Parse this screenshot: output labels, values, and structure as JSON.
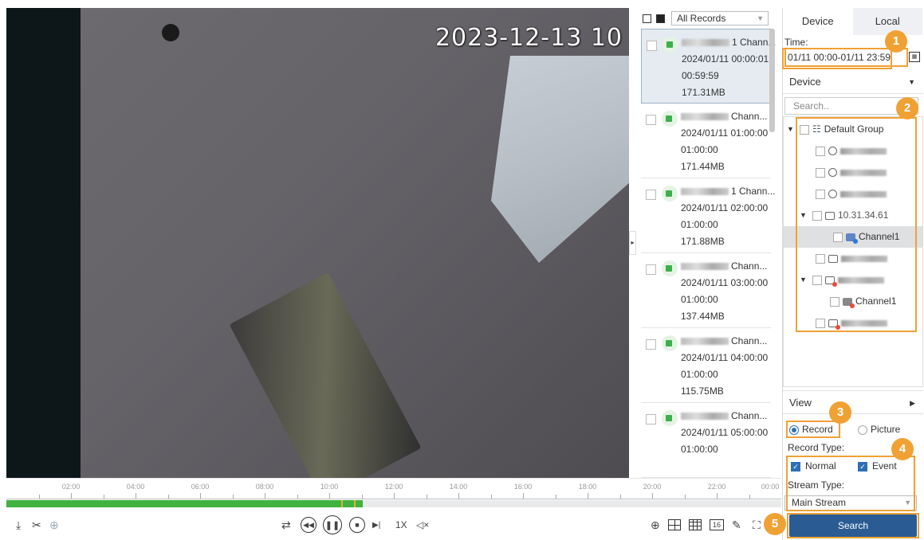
{
  "video": {
    "osd_timestamp": "2023-12-13 10"
  },
  "timeline": {
    "hour_labels": [
      "02:00",
      "04:00",
      "06:00",
      "08:00",
      "10:00",
      "12:00",
      "14:00",
      "16:00",
      "18:00",
      "20:00",
      "22:00",
      "00:00"
    ],
    "recorded_fraction": 0.46
  },
  "toolbar": {
    "speed": "1X",
    "grid_count": "16"
  },
  "records": {
    "filter": "All Records",
    "items": [
      {
        "channel": "1 Chann...",
        "start": "2024/01/11 00:00:01",
        "duration": "00:59:59",
        "size": "171.31MB",
        "selected": true
      },
      {
        "channel": "Chann...",
        "start": "2024/01/11 01:00:00",
        "duration": "01:00:00",
        "size": "171.44MB",
        "selected": false
      },
      {
        "channel": "1 Chann...",
        "start": "2024/01/11 02:00:00",
        "duration": "01:00:00",
        "size": "171.88MB",
        "selected": false
      },
      {
        "channel": "Chann...",
        "start": "2024/01/11 03:00:00",
        "duration": "01:00:00",
        "size": "137.44MB",
        "selected": false
      },
      {
        "channel": "Chann...",
        "start": "2024/01/11 04:00:00",
        "duration": "01:00:00",
        "size": "115.75MB",
        "selected": false
      },
      {
        "channel": "Chann...",
        "start": "2024/01/11 05:00:00",
        "duration": "01:00:00",
        "size": "",
        "selected": false
      }
    ]
  },
  "panel": {
    "tab_device": "Device",
    "tab_local": "Local",
    "time_label": "Time:",
    "time_value": "01/11 00:00-01/11 23:59",
    "device_dropdown": "Device",
    "search_placeholder": "Search..",
    "tree": {
      "group": "Default Group",
      "channel1_a": "Channel1",
      "channel1_b": "Channel1",
      "ip_partial": "10.31.34.61"
    },
    "view_label": "View",
    "record_option": "Record",
    "picture_option": "Picture",
    "record_type_label": "Record Type:",
    "normal_label": "Normal",
    "event_label": "Event",
    "stream_type_label": "Stream Type:",
    "stream_value": "Main Stream",
    "search_button": "Search"
  },
  "callouts": [
    "1",
    "2",
    "3",
    "4",
    "5"
  ],
  "colors": {
    "accent": "#f0a134",
    "primary_button": "#2a5c93",
    "record_green": "#3fb23f"
  }
}
